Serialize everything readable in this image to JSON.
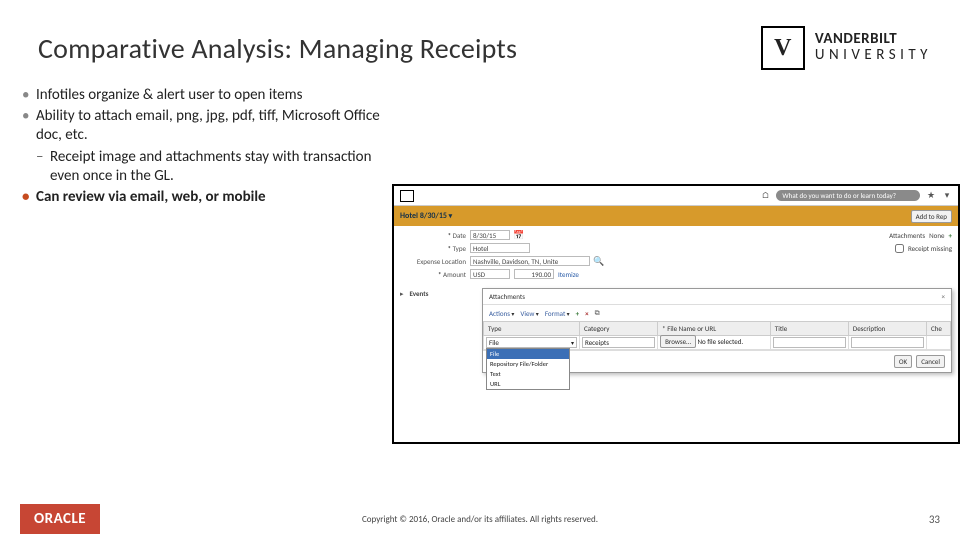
{
  "header": {
    "title": "Comparative Analysis: Managing Receipts",
    "logo": {
      "mark": "V",
      "line1": "VANDERBILT",
      "line2": "UNIVERSITY"
    }
  },
  "bullets": {
    "b1": "Infotiles organize & alert user to open items",
    "b2": "Ability to attach email, png, jpg, pdf, tiff, Microsoft Office doc, etc.",
    "b2sub": "Receipt image and attachments stay with transaction even once in the GL.",
    "b3": "Can review via email, web, or mobile"
  },
  "screenshot": {
    "search_placeholder": "What do you want to do or learn today?",
    "orange": {
      "title": "Hotel 8/30/15",
      "btn_add": "Add to Rep"
    },
    "form": {
      "date_lbl": "Date",
      "date_val": "8/30/15",
      "type_lbl": "Type",
      "type_val": "Hotel",
      "loc_lbl": "Expense Location",
      "loc_val": "Nashville, Davidson, TN, Unite",
      "amt_lbl": "Amount",
      "amt_cur": "USD",
      "amt_val": "190.00",
      "amt_note": "Itemize",
      "attach_lbl": "Attachments",
      "attach_val": "None",
      "missing": "Receipt missing",
      "events": "Events"
    },
    "modal": {
      "title": "Attachments",
      "actions_lbl": "Actions",
      "view_lbl": "View",
      "format_lbl": "Format",
      "col_type": "Type",
      "col_cat": "Category",
      "col_file": "File Name or URL",
      "col_title": "Title",
      "col_desc": "Description",
      "col_che": "Che",
      "row_type_sel": "File",
      "row_cat": "Receipts",
      "row_browse": "Browse…",
      "row_file": "No file selected.",
      "opts": [
        "File",
        "Repository File/Folder",
        "Text",
        "URL"
      ],
      "btn_ok": "OK",
      "btn_cancel": "Cancel"
    }
  },
  "footer": {
    "oracle": "ORACLE",
    "copyright": "Copyright © 2016, Oracle and/or its affiliates. All rights reserved.",
    "page": "33"
  }
}
